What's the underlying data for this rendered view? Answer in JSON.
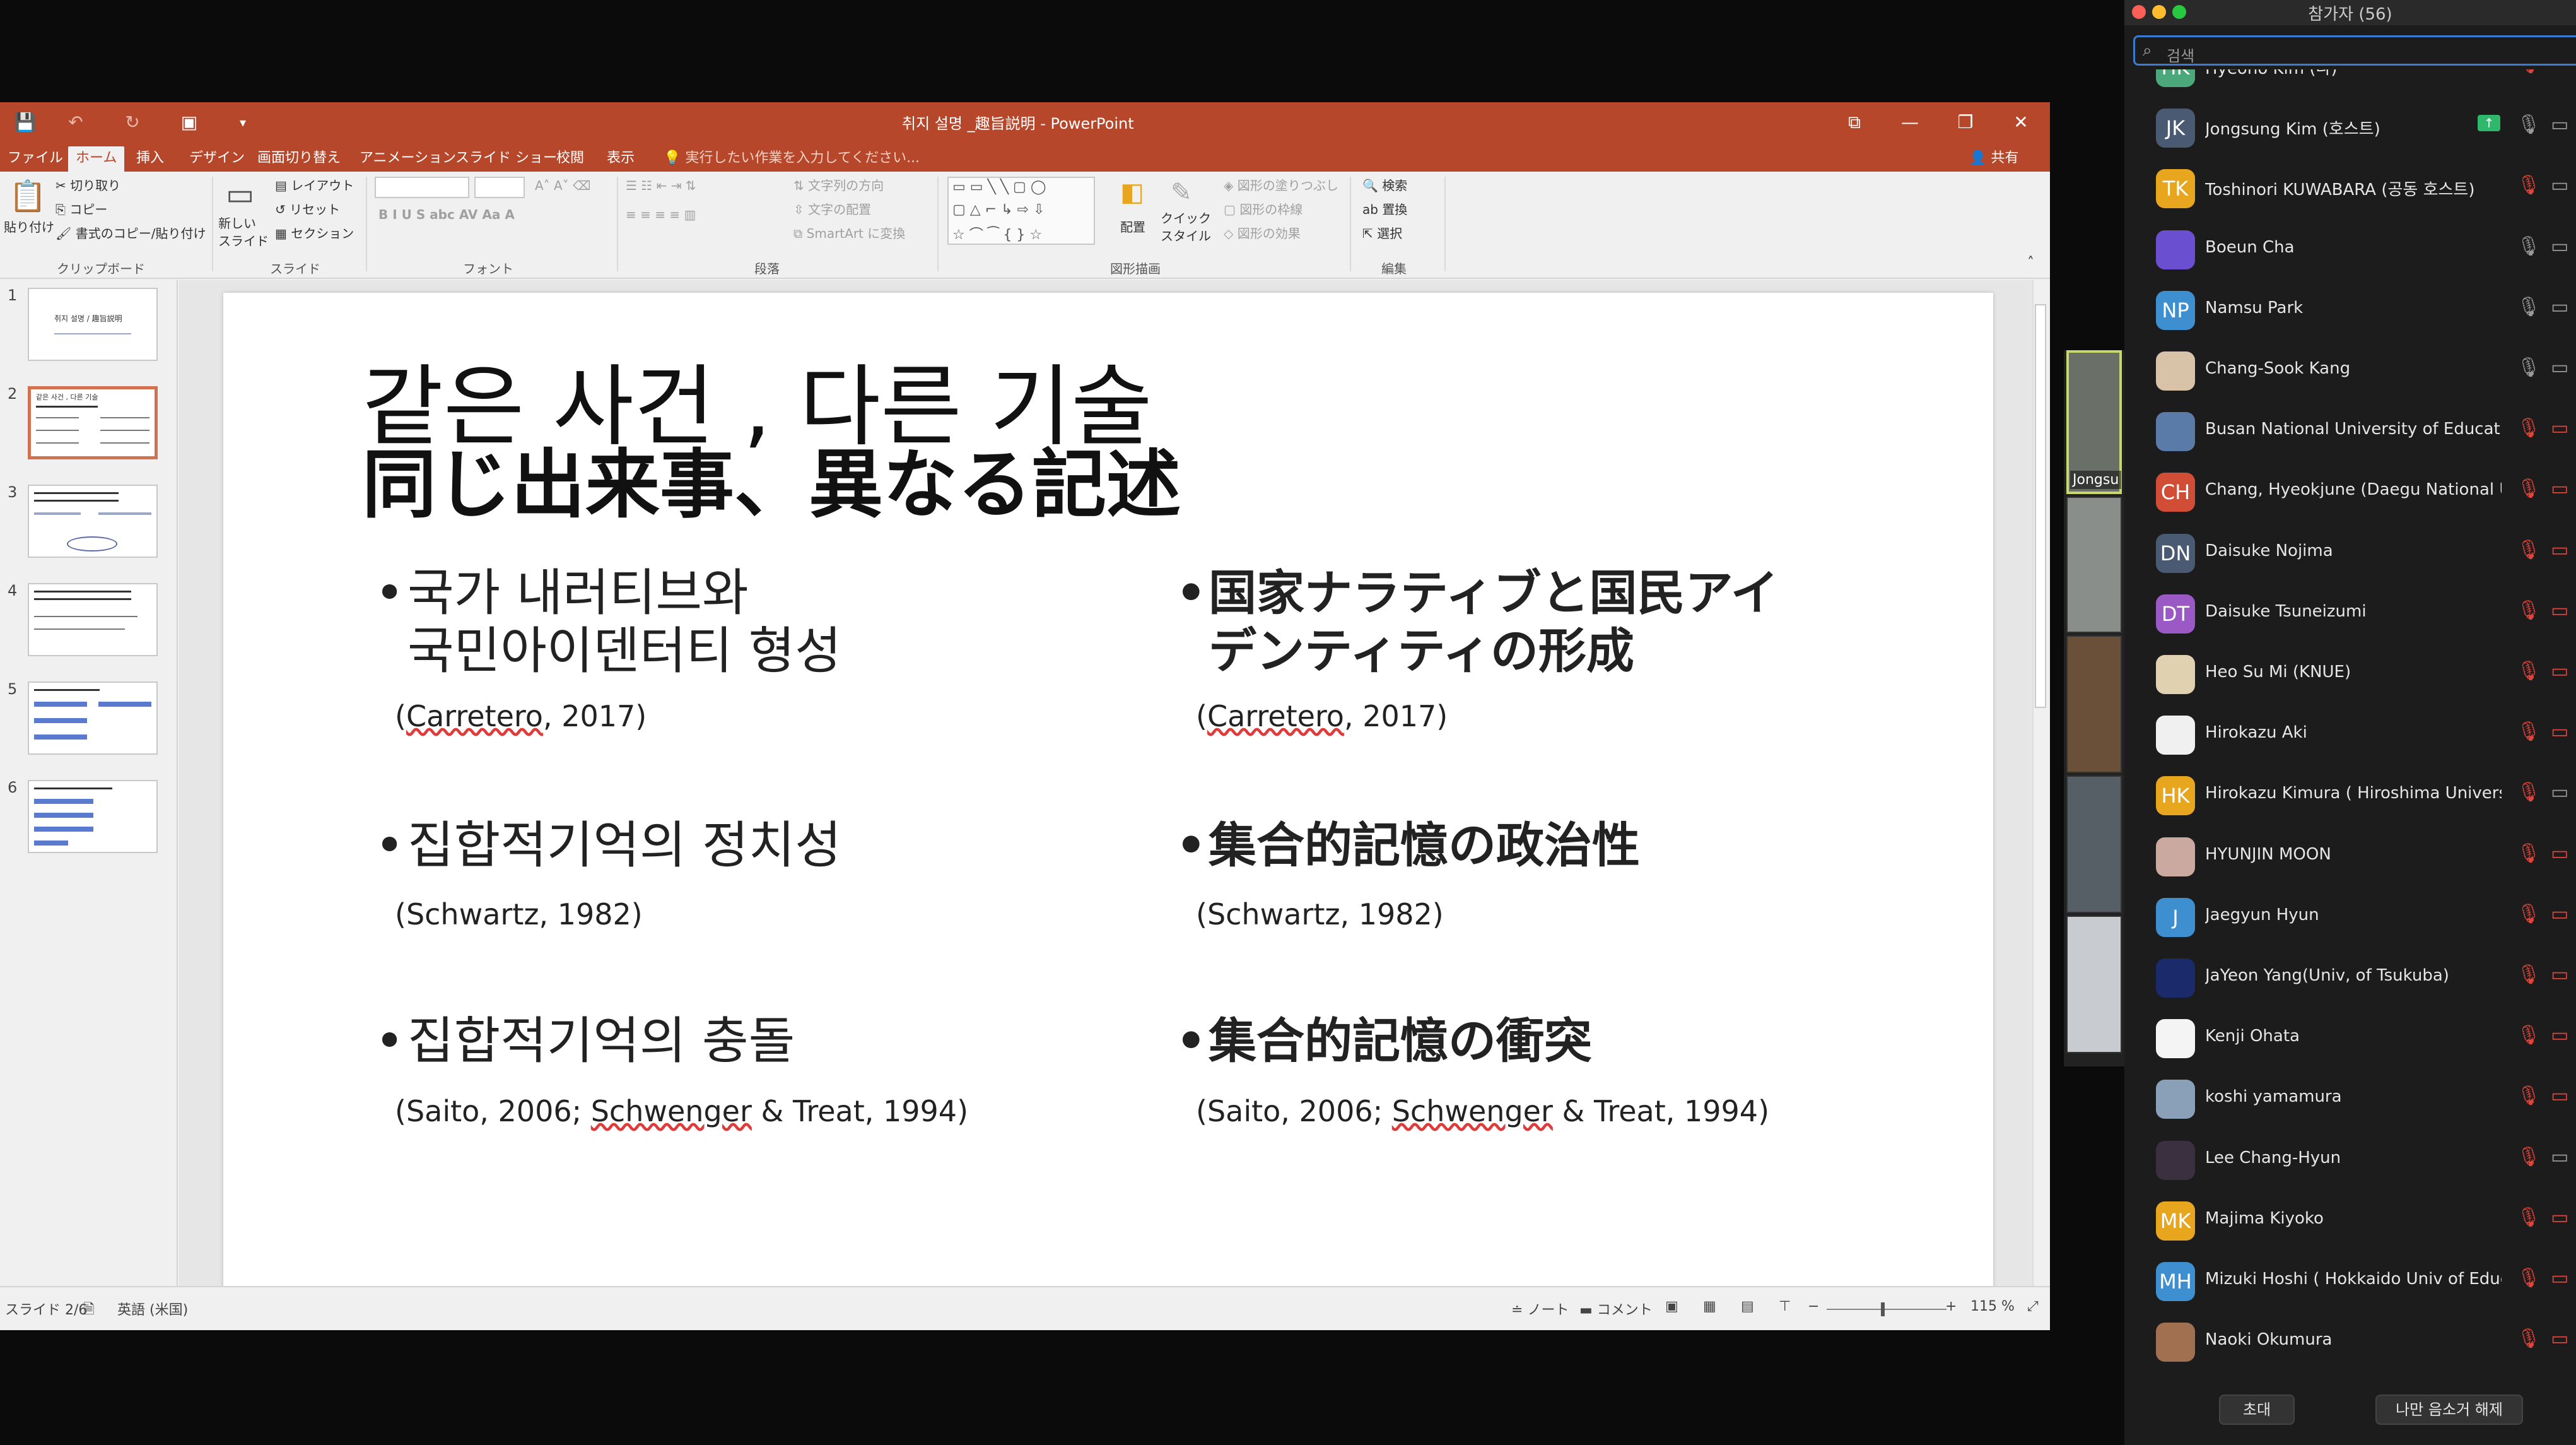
{
  "ppt": {
    "title": "취지 설명 _趣旨説明 - PowerPoint",
    "qat": {
      "save": "💾",
      "undo": "↶",
      "redo": "↻",
      "present": "▣",
      "customize": "▾"
    },
    "window": {
      "ribbon_opts": "⧉",
      "minimize": "—",
      "restore": "❐",
      "close": "✕"
    },
    "tabs": [
      "ファイル",
      "ホーム",
      "挿入",
      "デザイン",
      "画面切り替え",
      "アニメーション",
      "スライド ショー",
      "校閲",
      "表示"
    ],
    "tellme": "実行したい作業を入力してください...",
    "share": "共有",
    "ribbon": {
      "paste": "貼り付け",
      "cut": "切り取り",
      "copy": "コピー",
      "format_painter": "書式のコピー/貼り付け",
      "clipboard": "クリップボード",
      "new_slide": "新しい\nスライド",
      "layout": "レイアウト",
      "reset": "リセット",
      "section": "セクション",
      "slides": "スライド",
      "font": "フォント",
      "font_buttons": "B I U S abc AV Aa A",
      "text_direction": "文字列の方向",
      "align_text": "文字の配置",
      "smartart": "SmartArt に変換",
      "paragraph": "段落",
      "arrange": "配置",
      "quick_styles": "クイック\nスタイル",
      "shape_fill": "図形の塗りつぶし",
      "shape_outline": "図形の枠線",
      "shape_effects": "図形の効果",
      "drawing": "図形描画",
      "find": "検索",
      "replace": "置換",
      "select": "選択",
      "editing": "編集"
    },
    "thumbnails": [
      {
        "num": "1",
        "text": "취지 설명 / 趣旨説明"
      },
      {
        "num": "2",
        "text": "같은 사건 , 다른 기술"
      },
      {
        "num": "3",
        "text": ""
      },
      {
        "num": "4",
        "text": ""
      },
      {
        "num": "5",
        "text": ""
      },
      {
        "num": "6",
        "text": ""
      }
    ],
    "slide": {
      "title_ko": "같은 사건 , 다른 기술",
      "title_ja": "同じ出来事、異なる記述",
      "left": [
        {
          "text": "국가 내러티브와",
          "text2": "국민아이덴터티 형성",
          "cite_pre": "(",
          "cite_sq": "Carretero",
          "cite_post": ", 2017)"
        },
        {
          "text": "집합적기억의 정치성",
          "text2": "",
          "cite_pre": "(Schwartz, 1982)",
          "cite_sq": "",
          "cite_post": ""
        },
        {
          "text": "집합적기억의 충돌",
          "text2": "",
          "cite_pre": "(Saito, 2006; ",
          "cite_sq": "Schwenger",
          "cite_post": " & Treat, 1994)"
        }
      ],
      "right": [
        {
          "text": "国家ナラティブと国民アイ",
          "text2": "デンティティの形成",
          "cite_pre": "(",
          "cite_sq": "Carretero",
          "cite_post": ", 2017)"
        },
        {
          "text": "集合的記憶の政治性",
          "text2": "",
          "cite_pre": "(Schwartz, 1982)",
          "cite_sq": "",
          "cite_post": ""
        },
        {
          "text": "集合的記憶の衝突",
          "text2": "",
          "cite_pre": "(Saito, 2006; ",
          "cite_sq": "Schwenger",
          "cite_post": " & Treat, 1994)"
        }
      ]
    },
    "status": {
      "slide": "スライド 2/6",
      "lang": "英語 (米国)",
      "notes": "ノート",
      "comments": "コメント",
      "zoom": "115 %"
    }
  },
  "video": {
    "name_label": "Jongsu"
  },
  "zoom": {
    "title": "참가자 (56)",
    "search_placeholder": "검색",
    "participants": [
      {
        "initials": "HK",
        "name": "Hyeoho Kim (나)",
        "color": "#4aa87a",
        "mic": "muted",
        "cam": "off",
        "share": false
      },
      {
        "initials": "JK",
        "name": "Jongsung Kim (호스트)",
        "color": "#4a5a73",
        "mic": "on",
        "cam": "on",
        "share": true
      },
      {
        "initials": "TK",
        "name": "Toshinori KUWABARA (공동 호스트)",
        "color": "#e8a61e",
        "mic": "muted",
        "cam": "on",
        "share": false
      },
      {
        "initials": "",
        "name": "Boeun Cha",
        "color": "#6a4fd0",
        "mic": "on",
        "cam": "on",
        "share": false
      },
      {
        "initials": "NP",
        "name": "Namsu Park",
        "color": "#3d8fd0",
        "mic": "on",
        "cam": "on",
        "share": false
      },
      {
        "initials": "",
        "name": "Chang-Sook Kang",
        "color": "#d8c2a8",
        "mic": "on",
        "cam": "on",
        "share": false
      },
      {
        "initials": "",
        "name": "Busan National University of Educati...",
        "color": "#5a7aa8",
        "mic": "muted",
        "cam": "off",
        "share": false
      },
      {
        "initials": "CH",
        "name": "Chang, Hyeokjune (Daegu National U...",
        "color": "#d24d35",
        "mic": "muted",
        "cam": "off",
        "share": false
      },
      {
        "initials": "DN",
        "name": "Daisuke Nojima",
        "color": "#4a5a73",
        "mic": "muted",
        "cam": "off",
        "share": false
      },
      {
        "initials": "DT",
        "name": "Daisuke Tsuneizumi",
        "color": "#9b59c6",
        "mic": "muted",
        "cam": "off",
        "share": false
      },
      {
        "initials": "",
        "name": "Heo Su Mi (KNUE)",
        "color": "#e0d2b0",
        "mic": "muted",
        "cam": "off",
        "share": false
      },
      {
        "initials": "",
        "name": "Hirokazu Aki",
        "color": "#f0f0f0",
        "mic": "muted",
        "cam": "off",
        "share": false
      },
      {
        "initials": "HK",
        "name": "Hirokazu Kimura ( Hiroshima Universi...",
        "color": "#e8a61e",
        "mic": "muted",
        "cam": "on",
        "share": false
      },
      {
        "initials": "",
        "name": "HYUNJIN MOON",
        "color": "#c9a9a0",
        "mic": "muted",
        "cam": "off",
        "share": false
      },
      {
        "initials": "J",
        "name": "Jaegyun Hyun",
        "color": "#3d8fd0",
        "mic": "muted",
        "cam": "off",
        "share": false
      },
      {
        "initials": "",
        "name": "JaYeon Yang(Univ, of Tsukuba)",
        "color": "#1a2a6a",
        "mic": "muted",
        "cam": "off",
        "share": false
      },
      {
        "initials": "",
        "name": "Kenji Ohata",
        "color": "#f4f4f4",
        "mic": "muted",
        "cam": "off",
        "share": false
      },
      {
        "initials": "",
        "name": "koshi yamamura",
        "color": "#8aa0b8",
        "mic": "muted",
        "cam": "off",
        "share": false
      },
      {
        "initials": "",
        "name": "Lee Chang-Hyun",
        "color": "#3a3040",
        "mic": "muted",
        "cam": "on",
        "share": false
      },
      {
        "initials": "MK",
        "name": "Majima Kiyoko",
        "color": "#e8a61e",
        "mic": "muted",
        "cam": "off",
        "share": false
      },
      {
        "initials": "MH",
        "name": "Mizuki Hoshi ( Hokkaido Univ of Educ...",
        "color": "#3d8fd0",
        "mic": "muted",
        "cam": "off",
        "share": false
      },
      {
        "initials": "",
        "name": "Naoki Okumura",
        "color": "#a07050",
        "mic": "muted",
        "cam": "off",
        "share": false
      }
    ],
    "invite": "초대",
    "unmute_me": "나만 음소거 해제"
  },
  "colors": {
    "ppt_accent": "#b7472a",
    "zoom_bg": "#1c1c1c",
    "muted_red": "#e0453c",
    "zoom_blue": "#3a7bd5"
  }
}
